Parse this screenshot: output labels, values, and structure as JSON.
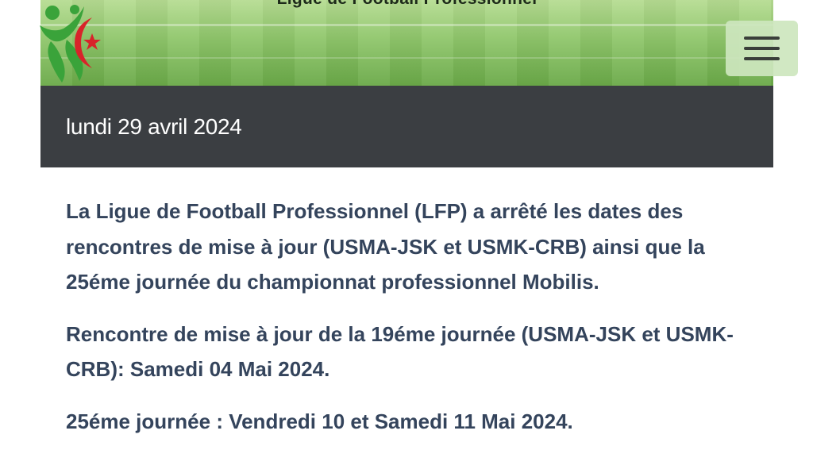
{
  "header": {
    "banner_title": "Ligue de Football Professionnel",
    "logo_icon": "lfp-logo-icon",
    "menu_icon": "hamburger-menu-icon"
  },
  "article": {
    "date": "lundi 29 avril 2024",
    "paragraphs": [
      "La Ligue de Football Professionnel (LFP) a arrêté les dates des rencontres de mise à jour (USMA-JSK et USMK-CRB) ainsi que la 25éme journée du championnat professionnel Mobilis.",
      "Rencontre de mise à jour de la 19éme journée (USMA-JSK et USMK-CRB): Samedi 04 Mai 2024.",
      "25éme journée : Vendredi 10 et Samedi 11 Mai 2024."
    ]
  },
  "colors": {
    "date_bar": "#3b3e42",
    "body_text": "#34445c",
    "logo_green": "#3aa33a",
    "logo_red": "#d8232a"
  }
}
